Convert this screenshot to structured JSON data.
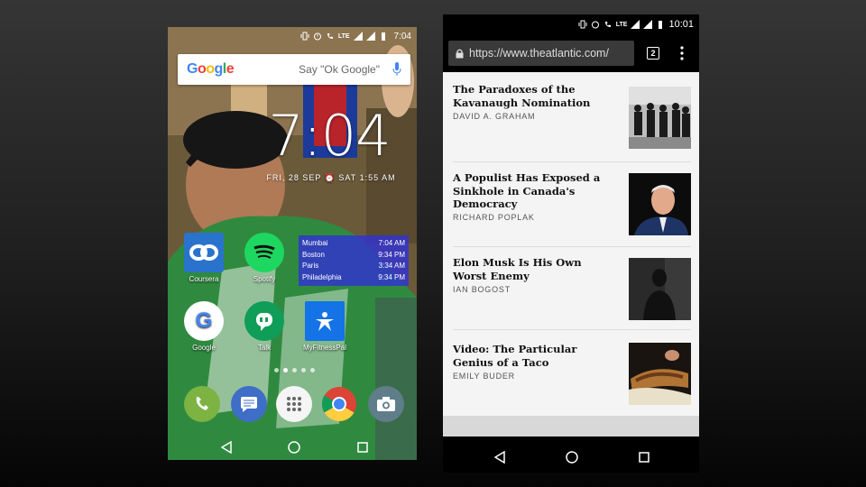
{
  "left_phone": {
    "status_bar": {
      "time": "7:04",
      "network": "LTE"
    },
    "google_search": {
      "logo": "Google",
      "hint": "Say \"Ok Google\""
    },
    "clock": {
      "time": "7:04",
      "date_alarm": "FRI, 28 SEP ⏰ SAT 1:55 AM"
    },
    "apps": [
      {
        "label": "Coursera",
        "icon": "coursera-icon"
      },
      {
        "label": "Spotify",
        "icon": "spotify-icon"
      },
      {
        "label": "Google",
        "icon": "google-icon"
      },
      {
        "label": "Talk",
        "icon": "hangouts-icon"
      },
      {
        "label": "MyFitnessPal",
        "icon": "myfitnesspal-icon"
      }
    ],
    "world_clock": [
      {
        "city": "Mumbai",
        "time": "7:04 AM"
      },
      {
        "city": "Boston",
        "time": "9:34 PM"
      },
      {
        "city": "Paris",
        "time": "3:34 AM"
      },
      {
        "city": "Philadelphia",
        "time": "9:34 PM"
      }
    ],
    "dock": [
      "phone-icon",
      "messages-icon",
      "app-drawer-icon",
      "chrome-icon",
      "camera-icon"
    ],
    "colors": {
      "world_clock_bg": "#3232d2",
      "shirt": "#2d8a3e"
    }
  },
  "right_phone": {
    "status_bar": {
      "time": "10:01",
      "network": "LTE"
    },
    "browser": {
      "url": "https://www.theatlantic.com/",
      "tab_count": "2"
    },
    "articles": [
      {
        "title": "The Paradoxes of the Kavanaugh Nomination",
        "author": "DAVID A. GRAHAM"
      },
      {
        "title": "A Populist Has Exposed a Sinkhole in Canada's Democracy",
        "author": "RICHARD POPLAK"
      },
      {
        "title": "Elon Musk Is His Own Worst Enemy",
        "author": "IAN BOGOST"
      },
      {
        "title": "Video: The Particular Genius of a Taco",
        "author": "EMILY BUDER"
      }
    ]
  }
}
